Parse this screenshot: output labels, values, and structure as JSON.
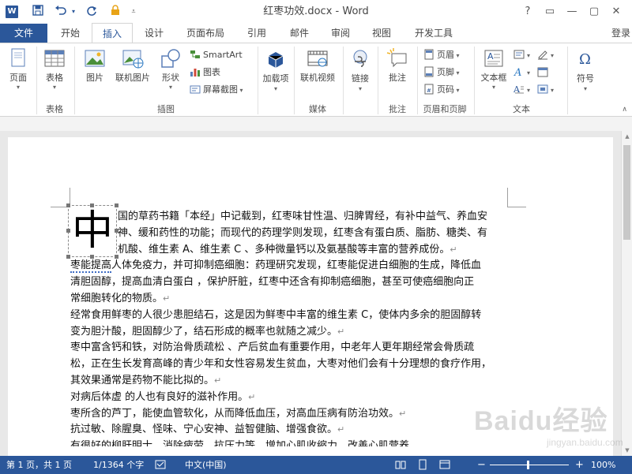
{
  "window": {
    "title": "红枣功效.docx - Word",
    "app_icon_letter": "W",
    "controls": {
      "help": "?",
      "restore_ribbon": "▭",
      "minimize": "—",
      "maximize": "▢",
      "close": "✕"
    }
  },
  "quick_access": {
    "save_icon": "save-icon",
    "undo_icon": "undo-icon",
    "redo_icon": "redo-icon",
    "lock_icon": "lock-icon",
    "customize_icon": "customize-qat-icon"
  },
  "tabs": {
    "file": "文件",
    "items": [
      "开始",
      "插入",
      "设计",
      "页面布局",
      "引用",
      "邮件",
      "审阅",
      "视图",
      "开发工具"
    ],
    "active": "插入",
    "login": "登录"
  },
  "ribbon": {
    "pages": {
      "btn": "页面",
      "group": ""
    },
    "tables": {
      "btn": "表格",
      "group": "表格"
    },
    "illustrations": {
      "picture": "图片",
      "online_picture": "联机图片",
      "shapes": "形状",
      "smartart": "SmartArt",
      "chart": "图表",
      "screenshot": "屏幕截图",
      "group": "插图"
    },
    "addins": {
      "btn": "加载项",
      "group": ""
    },
    "media": {
      "btn": "联机视频",
      "group": "媒体"
    },
    "links": {
      "btn": "链接",
      "group": ""
    },
    "comments": {
      "btn": "批注",
      "group": "批注"
    },
    "header_footer": {
      "header": "页眉",
      "footer": "页脚",
      "page_number": "页码",
      "group": "页眉和页脚"
    },
    "text": {
      "textbox": "文本框",
      "group": "文本"
    },
    "symbols": {
      "btn": "符号",
      "group": ""
    }
  },
  "document": {
    "dropcap": "中",
    "paragraphs": [
      {
        "text": "国的草药书籍「本经」中记载到，红枣味甘性温、归脾胃经，有补中益气、养血安",
        "indent": true
      },
      {
        "text": "神、缓和药性的功能；而现代的药理学则发现，红枣含有蛋白质、脂肪、糖类、有",
        "indent": true
      },
      {
        "text": "机酸、维生素 A、维生素 C 、多种微量钙以及氨基酸等丰富的营养成份。",
        "indent": true,
        "mark": true
      },
      {
        "text_underlined": "枣能提高",
        "text": "人体免疫力，并可抑制癌细胞：药理研究发现，红枣能促进白细胞的生成，降低血"
      },
      {
        "text": "清胆固醇，提高血清白蛋白 ，保护肝脏，红枣中还含有抑制癌细胞，甚至可使癌细胞向正"
      },
      {
        "text": "常细胞转化的物质。",
        "mark": true
      },
      {
        "text": "经常食用鲜枣的人很少患胆结石，这是因为鲜枣中丰富的维生素 C，使体内多余的胆固醇转"
      },
      {
        "text": "变为胆汁酸，胆固醇少了，结石形成的概率也就随之减少。",
        "mark": true
      },
      {
        "text": "枣中富含钙和铁，对防治骨质疏松 、产后贫血有重要作用，中老年人更年期经常会骨质疏"
      },
      {
        "text": "松，正在生长发育高峰的青少年和女性容易发生贫血，大枣对他们会有十分理想的食疗作用，"
      },
      {
        "text": "其效果通常是药物不能比拟的。",
        "mark": true
      },
      {
        "text": "对病后体虚 的人也有良好的滋补作用。",
        "mark": true
      },
      {
        "text": "枣所含的芦丁，能使血管软化，从而降低血压，对高血压病有防治功效。",
        "mark": true
      },
      {
        "text": "抗过敏、除腥臭、怪味、宁心安神、益智健脑、增强食欲。",
        "mark": true
      },
      {
        "text": "有很好的柳肝明士，消除疲劳，抗压力等，增加心肌收缩力，改善心肌营养",
        "mark": true
      }
    ],
    "paragraph_mark": "↵"
  },
  "watermark": {
    "main": "Baidu经验",
    "sub": "jingyan.baidu.com"
  },
  "status": {
    "page": "第 1 页，共 1 页",
    "words": "1/1364 个字",
    "lang": "中文(中国)",
    "zoom": "100%",
    "zoom_minus": "−",
    "zoom_plus": "+"
  }
}
